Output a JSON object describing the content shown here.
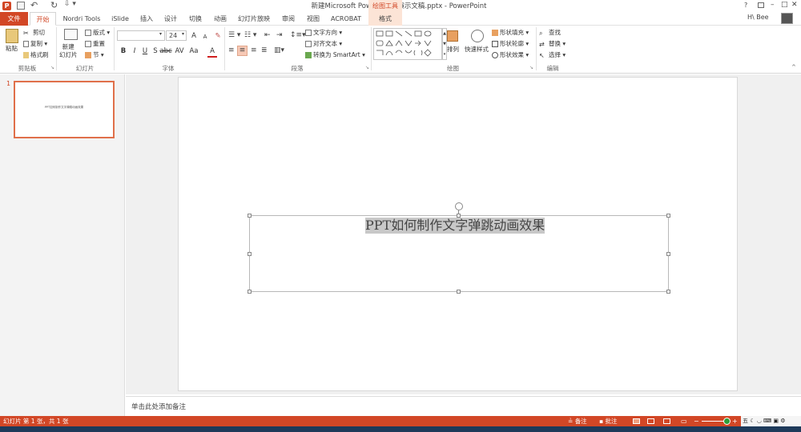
{
  "window": {
    "title": "新建Microsoft PowerPoint 演示文稿.pptx - PowerPoint",
    "user": "H\\ Bee",
    "help": "?",
    "min": "–",
    "max": "□",
    "close": "✕"
  },
  "tabs": [
    "文件",
    "开始",
    "Nordri Tools",
    "iSlide",
    "插入",
    "设计",
    "切换",
    "动画",
    "幻灯片放映",
    "审阅",
    "视图",
    "ACROBAT",
    "格式"
  ],
  "context_tab_header": "绘图工具",
  "ribbon": {
    "clipboard": {
      "paste": "粘贴",
      "cut": "剪切",
      "copy": "复制",
      "painter": "格式刷",
      "group": "剪贴板"
    },
    "slides": {
      "new_slide": "新建\n幻灯片",
      "layout": "版式",
      "reset": "重置",
      "section": "节",
      "group": "幻灯片"
    },
    "font": {
      "name": "",
      "size": "24",
      "bold": "B",
      "italic": "I",
      "underline": "U",
      "strike": "S",
      "shadow": "abc",
      "spacing": "AV",
      "case": "Aa",
      "color": "A",
      "grow": "A",
      "shrink": "A",
      "group": "字体"
    },
    "paragraph": {
      "text_direction": "文字方向",
      "align_text": "对齐文本",
      "smartart": "转换为 SmartArt",
      "group": "段落"
    },
    "drawing": {
      "arrange": "排列",
      "quick_styles": "快速样式",
      "fill": "形状填充",
      "outline": "形状轮廓",
      "effects": "形状效果",
      "group": "绘图"
    },
    "editing": {
      "find": "查找",
      "replace": "替换",
      "select": "选择",
      "group": "编辑"
    }
  },
  "thumbnail": {
    "number": "1",
    "text": "PPT如何制作文字弹跳动画效果"
  },
  "slide": {
    "text": "PPT如何制作文字弹跳动画效果"
  },
  "notes_placeholder": "单击此处添加备注",
  "statusbar": {
    "slide_info": "幻灯片 第 1 张，共 1 张",
    "notes": "备注",
    "comments": "批注"
  },
  "colors": {
    "accent": "#d24726"
  }
}
